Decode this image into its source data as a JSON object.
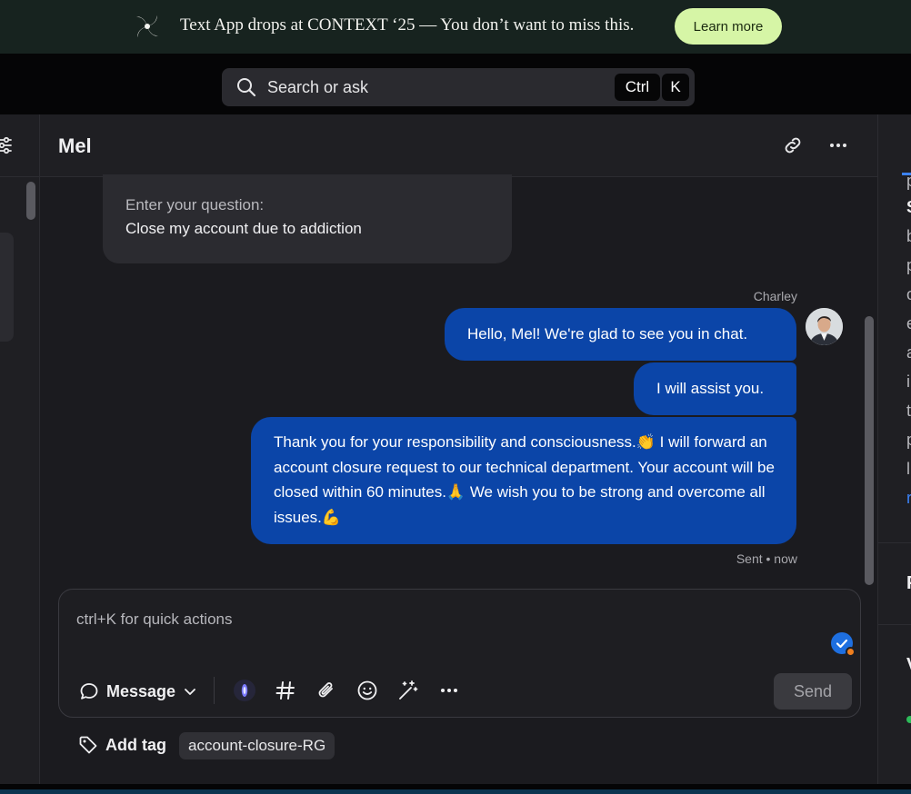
{
  "banner": {
    "text": "Text App drops at CONTEXT ‘25 — You don’t want to miss this.",
    "button": "Learn more"
  },
  "search": {
    "placeholder": "Search or ask",
    "shortcut_ctrl": "Ctrl",
    "shortcut_key": "K"
  },
  "chat": {
    "contact_name": "Mel",
    "question_label": "Enter your question:",
    "question_value": "Close my account due to addiction",
    "agent_name": "Charley",
    "messages": [
      "Hello, Mel! We're glad to see you in chat.",
      "I will assist you.",
      "Thank you for your responsibility and consciousness.👏 I will forward an account closure request to our technical department. Your account will be closed within 60 minutes.🙏 We wish you to be strong and overcome all issues.💪"
    ],
    "status": "Sent • now"
  },
  "composer": {
    "placeholder": "ctrl+K for quick actions",
    "mode": "Message",
    "send": "Send"
  },
  "tags": {
    "add_label": "Add tag",
    "items": [
      "account-closure-RG"
    ]
  },
  "right_panel": {
    "lines": [
      "p",
      "S",
      "b",
      "p",
      "o",
      "e",
      "a",
      "i",
      "t",
      "p",
      "l",
      "r"
    ],
    "section_1": "P",
    "section_2": "V"
  },
  "colors": {
    "accent": "#0b45a8",
    "banner_bg": "#17231f",
    "learn_btn": "#d6f5a6",
    "check_badge": "#1e6fe0",
    "status_dot": "#f07f1e",
    "online_dot": "#2dbb5a"
  }
}
